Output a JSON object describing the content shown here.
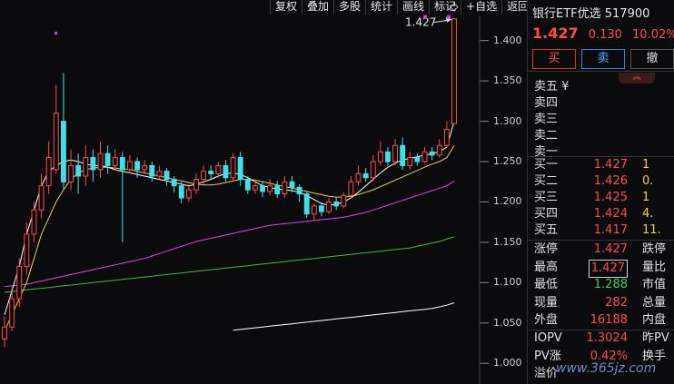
{
  "toolbar": {
    "items": [
      "复权",
      "叠加",
      "多股",
      "统计",
      "画线",
      "标记",
      "+自选",
      "返回"
    ]
  },
  "chart": {
    "y_ticks": [
      "1.400",
      "1.350",
      "1.300",
      "1.250",
      "1.200",
      "1.150",
      "1.100",
      "1.050",
      "1.000"
    ],
    "last_price_label": "1.427",
    "colors": {
      "up": "#ff4a4a",
      "down": "#40e0e8",
      "ma5": "#ffffff",
      "ma10": "#e8d040",
      "ma20": "#e040e0",
      "ma60": "#30c040",
      "ma120": "#ffffff"
    }
  },
  "chart_data": {
    "type": "candlestick",
    "ylim": [
      0.98,
      1.43
    ],
    "candles": [
      [
        1.03,
        1.045,
        1.02,
        1.058
      ],
      [
        1.045,
        1.08,
        1.04,
        1.09
      ],
      [
        1.08,
        1.12,
        1.07,
        1.13
      ],
      [
        1.12,
        1.16,
        1.11,
        1.175
      ],
      [
        1.16,
        1.19,
        1.15,
        1.2
      ],
      [
        1.19,
        1.22,
        1.18,
        1.235
      ],
      [
        1.22,
        1.255,
        1.21,
        1.275
      ],
      [
        1.24,
        1.31,
        1.235,
        1.345
      ],
      [
        1.3,
        1.225,
        1.215,
        1.36
      ],
      [
        1.225,
        1.245,
        1.215,
        1.265
      ],
      [
        1.245,
        1.232,
        1.21,
        1.26
      ],
      [
        1.232,
        1.255,
        1.22,
        1.27
      ],
      [
        1.255,
        1.24,
        1.225,
        1.265
      ],
      [
        1.24,
        1.26,
        1.23,
        1.275
      ],
      [
        1.26,
        1.245,
        1.235,
        1.27
      ],
      [
        1.245,
        1.255,
        1.24,
        1.265
      ],
      [
        1.255,
        1.24,
        1.15,
        1.262
      ],
      [
        1.24,
        1.25,
        1.235,
        1.258
      ],
      [
        1.25,
        1.24,
        1.23,
        1.255
      ],
      [
        1.24,
        1.245,
        1.235,
        1.252
      ],
      [
        1.245,
        1.232,
        1.225,
        1.25
      ],
      [
        1.232,
        1.238,
        1.228,
        1.245
      ],
      [
        1.238,
        1.228,
        1.22,
        1.242
      ],
      [
        1.228,
        1.22,
        1.212,
        1.232
      ],
      [
        1.22,
        1.205,
        1.198,
        1.225
      ],
      [
        1.205,
        1.215,
        1.2,
        1.222
      ],
      [
        1.215,
        1.228,
        1.21,
        1.235
      ],
      [
        1.228,
        1.238,
        1.222,
        1.245
      ],
      [
        1.238,
        1.235,
        1.228,
        1.245
      ],
      [
        1.235,
        1.245,
        1.23,
        1.25
      ],
      [
        1.245,
        1.23,
        1.225,
        1.252
      ],
      [
        1.23,
        1.255,
        1.225,
        1.26
      ],
      [
        1.255,
        1.228,
        1.22,
        1.262
      ],
      [
        1.228,
        1.215,
        1.21,
        1.232
      ],
      [
        1.215,
        1.22,
        1.21,
        1.228
      ],
      [
        1.22,
        1.213,
        1.206,
        1.226
      ],
      [
        1.213,
        1.22,
        1.208,
        1.228
      ],
      [
        1.22,
        1.21,
        1.205,
        1.226
      ],
      [
        1.21,
        1.225,
        1.205,
        1.232
      ],
      [
        1.225,
        1.218,
        1.212,
        1.232
      ],
      [
        1.218,
        1.21,
        1.2,
        1.222
      ],
      [
        1.21,
        1.185,
        1.18,
        1.212
      ],
      [
        1.185,
        1.195,
        1.178,
        1.198
      ],
      [
        1.195,
        1.188,
        1.182,
        1.2
      ],
      [
        1.188,
        1.2,
        1.185,
        1.205
      ],
      [
        1.2,
        1.195,
        1.19,
        1.206
      ],
      [
        1.195,
        1.208,
        1.192,
        1.212
      ],
      [
        1.208,
        1.225,
        1.205,
        1.232
      ],
      [
        1.225,
        1.235,
        1.22,
        1.245
      ],
      [
        1.235,
        1.23,
        1.225,
        1.242
      ],
      [
        1.23,
        1.25,
        1.225,
        1.258
      ],
      [
        1.25,
        1.262,
        1.245,
        1.275
      ],
      [
        1.262,
        1.25,
        1.245,
        1.268
      ],
      [
        1.25,
        1.27,
        1.245,
        1.278
      ],
      [
        1.27,
        1.245,
        1.24,
        1.28
      ],
      [
        1.245,
        1.255,
        1.24,
        1.262
      ],
      [
        1.255,
        1.25,
        1.245,
        1.26
      ],
      [
        1.25,
        1.262,
        1.248,
        1.268
      ],
      [
        1.262,
        1.258,
        1.252,
        1.268
      ],
      [
        1.258,
        1.27,
        1.255,
        1.278
      ],
      [
        1.27,
        1.29,
        1.268,
        1.3
      ],
      [
        1.297,
        1.427,
        1.297,
        1.427
      ]
    ],
    "ma": {
      "ma5": [
        1.06,
        1.09,
        1.12,
        1.16,
        1.19,
        1.22,
        1.238,
        1.245,
        1.25,
        1.252,
        1.25,
        1.247,
        1.245,
        1.245,
        1.243,
        1.24,
        1.238,
        1.236,
        1.234,
        1.232,
        1.23,
        1.228,
        1.226,
        1.224,
        1.222,
        1.22,
        1.222,
        1.225,
        1.228,
        1.232,
        1.235,
        1.236,
        1.234,
        1.23,
        1.225,
        1.22,
        1.218,
        1.216,
        1.215,
        1.214,
        1.212,
        1.208,
        1.203,
        1.198,
        1.196,
        1.197,
        1.2,
        1.205,
        1.212,
        1.22,
        1.228,
        1.236,
        1.243,
        1.248,
        1.252,
        1.254,
        1.256,
        1.258,
        1.26,
        1.262,
        1.268,
        1.3
      ],
      "ma10": [
        1.04,
        1.06,
        1.08,
        1.1,
        1.13,
        1.16,
        1.18,
        1.2,
        1.215,
        1.228,
        1.236,
        1.24,
        1.242,
        1.243,
        1.243,
        1.242,
        1.241,
        1.24,
        1.238,
        1.236,
        1.234,
        1.232,
        1.23,
        1.228,
        1.226,
        1.224,
        1.222,
        1.221,
        1.221,
        1.222,
        1.224,
        1.226,
        1.228,
        1.228,
        1.227,
        1.225,
        1.223,
        1.221,
        1.219,
        1.217,
        1.215,
        1.213,
        1.211,
        1.209,
        1.207,
        1.206,
        1.206,
        1.207,
        1.209,
        1.212,
        1.215,
        1.219,
        1.223,
        1.227,
        1.231,
        1.235,
        1.239,
        1.243,
        1.247,
        1.25,
        1.255,
        1.27
      ],
      "ma20": [
        1.095,
        1.096,
        1.097,
        1.098,
        1.1,
        1.102,
        1.104,
        1.106,
        1.108,
        1.11,
        1.112,
        1.114,
        1.116,
        1.118,
        1.12,
        1.122,
        1.124,
        1.126,
        1.128,
        1.13,
        1.133,
        1.136,
        1.139,
        1.142,
        1.145,
        1.148,
        1.151,
        1.153,
        1.155,
        1.157,
        1.159,
        1.161,
        1.163,
        1.165,
        1.167,
        1.169,
        1.171,
        1.172,
        1.173,
        1.174,
        1.175,
        1.176,
        1.177,
        1.178,
        1.179,
        1.18,
        1.181,
        1.183,
        1.185,
        1.187,
        1.19,
        1.193,
        1.196,
        1.199,
        1.202,
        1.205,
        1.208,
        1.211,
        1.214,
        1.217,
        1.22,
        1.226
      ],
      "ma60": [
        1.088,
        1.089,
        1.09,
        1.091,
        1.092,
        1.093,
        1.094,
        1.095,
        1.096,
        1.097,
        1.098,
        1.099,
        1.1,
        1.101,
        1.102,
        1.103,
        1.104,
        1.105,
        1.106,
        1.107,
        1.108,
        1.109,
        1.11,
        1.111,
        1.112,
        1.113,
        1.114,
        1.115,
        1.116,
        1.117,
        1.118,
        1.119,
        1.12,
        1.121,
        1.122,
        1.123,
        1.124,
        1.125,
        1.126,
        1.127,
        1.128,
        1.129,
        1.13,
        1.131,
        1.132,
        1.133,
        1.134,
        1.135,
        1.136,
        1.137,
        1.138,
        1.139,
        1.14,
        1.141,
        1.142,
        1.143,
        1.145,
        1.147,
        1.149,
        1.151,
        1.154,
        1.157
      ]
    },
    "ma120": {
      "start_index": 31,
      "values": [
        1.041,
        1.042,
        1.043,
        1.044,
        1.045,
        1.046,
        1.047,
        1.048,
        1.049,
        1.05,
        1.051,
        1.052,
        1.053,
        1.054,
        1.055,
        1.056,
        1.057,
        1.058,
        1.059,
        1.06,
        1.061,
        1.062,
        1.063,
        1.064,
        1.065,
        1.066,
        1.067,
        1.068,
        1.07,
        1.072,
        1.075
      ]
    }
  },
  "quote": {
    "title": "银行ETF优选  517900",
    "price": "1.427",
    "change": "0.130",
    "change_pct": "10.02%",
    "buy_label": "买",
    "sell_label": "卖",
    "cancel_label": "撤",
    "ask_levels": [
      {
        "label": "卖五 ¥"
      },
      {
        "label": "卖四"
      },
      {
        "label": "卖三"
      },
      {
        "label": "卖二"
      },
      {
        "label": "卖一"
      }
    ],
    "bid_levels": [
      {
        "label": "买一",
        "price": "1.427",
        "vol": "1"
      },
      {
        "label": "买二",
        "price": "1.426",
        "vol": "0."
      },
      {
        "label": "买三",
        "price": "1.425",
        "vol": "1"
      },
      {
        "label": "买四",
        "price": "1.424",
        "vol": "4."
      },
      {
        "label": "买五",
        "price": "1.417",
        "vol": "11."
      }
    ],
    "stats": [
      {
        "label": "涨停",
        "value": "1.427",
        "cls": "red",
        "label2": "跌停"
      },
      {
        "label": "最高",
        "value": "1.427",
        "cls": "red boxed",
        "label2": "量比"
      },
      {
        "label": "最低",
        "value": "1.288",
        "cls": "green",
        "label2": "市值"
      },
      {
        "label": "现量",
        "value": "282",
        "cls": "red",
        "label2": "总量"
      },
      {
        "label": "外盘",
        "value": "16188",
        "cls": "red",
        "label2": "内盘"
      }
    ],
    "iopv": [
      {
        "label": "IOPV",
        "value": "1.3024",
        "cls": "red",
        "label2": "昨PV"
      },
      {
        "label": "PV涨",
        "value": "0.42%",
        "cls": "red",
        "label2": "换手"
      },
      {
        "label": "溢价",
        "value": "",
        "cls": "red",
        "label2": ""
      }
    ]
  },
  "watermark": "www.365jz.com"
}
